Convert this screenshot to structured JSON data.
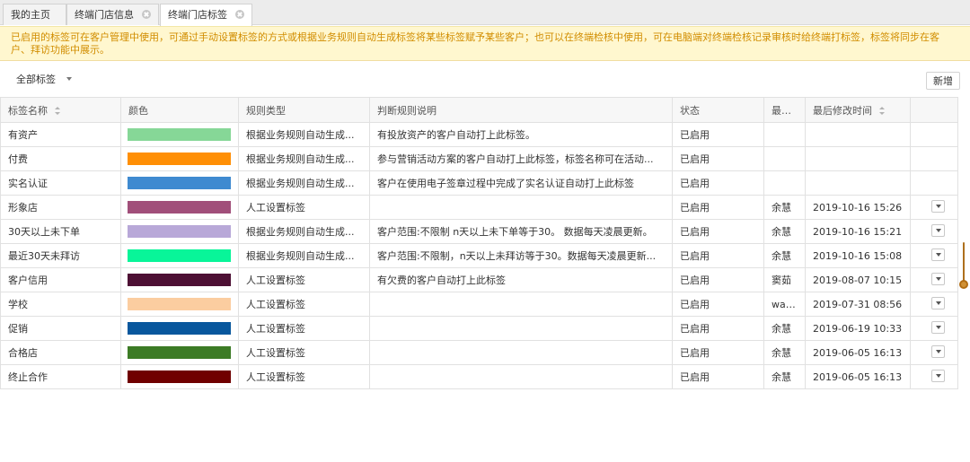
{
  "tabs": [
    {
      "label": "我的主页",
      "closable": false,
      "active": false
    },
    {
      "label": "终端门店信息",
      "closable": true,
      "active": false
    },
    {
      "label": "终端门店标签",
      "closable": true,
      "active": true
    }
  ],
  "notice": {
    "text": "已启用的标签可在客户管理中使用，可通过手动设置标签的方式或根据业务规则自动生成标签将某些标签赋予某些客户；也可以在终端检核中使用，可在电脑端对终端检核记录审核时给终端打标签，标签将同步在客户、拜访功能中展示。"
  },
  "toolbar": {
    "filter_label": "全部标签",
    "new_button_label": "新增"
  },
  "table": {
    "columns": [
      {
        "key": "name",
        "label": "标签名称",
        "sortable": true
      },
      {
        "key": "color",
        "label": "颜色",
        "sortable": false
      },
      {
        "key": "rule_type",
        "label": "规则类型",
        "sortable": false
      },
      {
        "key": "rule_desc",
        "label": "判断规则说明",
        "sortable": false
      },
      {
        "key": "status",
        "label": "状态",
        "sortable": false
      },
      {
        "key": "last_editor",
        "label": "最后...",
        "sortable": false
      },
      {
        "key": "modified_time",
        "label": "最后修改时间",
        "sortable": true
      },
      {
        "key": "actions",
        "label": "",
        "sortable": false
      }
    ],
    "rows": [
      {
        "name": "有资产",
        "color": "#86d797",
        "rule_type": "根据业务规则自动生成...",
        "rule_desc": "有投放资产的客户自动打上此标签。",
        "status": "已启用",
        "last_editor": "",
        "modified_time": "",
        "has_menu": false
      },
      {
        "name": "付费",
        "color": "#ff8f05",
        "rule_type": "根据业务规则自动生成...",
        "rule_desc": "参与营销活动方案的客户自动打上此标签，标签名称可在活动...",
        "status": "已启用",
        "last_editor": "",
        "modified_time": "",
        "has_menu": false
      },
      {
        "name": "实名认证",
        "color": "#3f8ad0",
        "rule_type": "根据业务规则自动生成...",
        "rule_desc": "客户在使用电子签章过程中完成了实名认证自动打上此标签",
        "status": "已启用",
        "last_editor": "",
        "modified_time": "",
        "has_menu": false
      },
      {
        "name": "形象店",
        "color": "#a14f7a",
        "rule_type": "人工设置标签",
        "rule_desc": "",
        "status": "已启用",
        "last_editor": "余慧",
        "modified_time": "2019-10-16 15:26",
        "has_menu": true
      },
      {
        "name": "30天以上未下单",
        "color": "#b8a8d8",
        "rule_type": "根据业务规则自动生成...",
        "rule_desc": "客户范围:不限制 n天以上未下单等于30。 数据每天凌晨更新。",
        "status": "已启用",
        "last_editor": "余慧",
        "modified_time": "2019-10-16 15:21",
        "has_menu": true
      },
      {
        "name": "最近30天未拜访",
        "color": "#08f599",
        "rule_type": "根据业务规则自动生成...",
        "rule_desc": "客户范围:不限制，n天以上未拜访等于30。数据每天凌晨更新...",
        "status": "已启用",
        "last_editor": "余慧",
        "modified_time": "2019-10-16 15:08",
        "has_menu": true
      },
      {
        "name": "客户信用",
        "color": "#4d1034",
        "rule_type": "人工设置标签",
        "rule_desc": "有欠费的客户自动打上此标签",
        "status": "已启用",
        "last_editor": "窦茹",
        "modified_time": "2019-08-07 10:15",
        "has_menu": true
      },
      {
        "name": "学校",
        "color": "#fbcda0",
        "rule_type": "人工设置标签",
        "rule_desc": "",
        "status": "已启用",
        "last_editor": "wai...",
        "modified_time": "2019-07-31 08:56",
        "has_menu": true
      },
      {
        "name": "促销",
        "color": "#08579d",
        "rule_type": "人工设置标签",
        "rule_desc": "",
        "status": "已启用",
        "last_editor": "余慧",
        "modified_time": "2019-06-19 10:33",
        "has_menu": true
      },
      {
        "name": "合格店",
        "color": "#3c7b25",
        "rule_type": "人工设置标签",
        "rule_desc": "",
        "status": "已启用",
        "last_editor": "余慧",
        "modified_time": "2019-06-05 16:13",
        "has_menu": true
      },
      {
        "name": "终止合作",
        "color": "#700000",
        "rule_type": "人工设置标签",
        "rule_desc": "",
        "status": "已启用",
        "last_editor": "余慧",
        "modified_time": "2019-06-05 16:13",
        "has_menu": true
      }
    ]
  },
  "colors": {
    "notice_text": "#d18d00",
    "notice_background": "#fff7cf",
    "scrollbar_accent": "#b16c12"
  },
  "icons": {
    "tab_close": "close-icon",
    "filter_caret": "caret-down-icon",
    "sort": "sort-icon",
    "row_menu": "chevron-down-icon"
  }
}
